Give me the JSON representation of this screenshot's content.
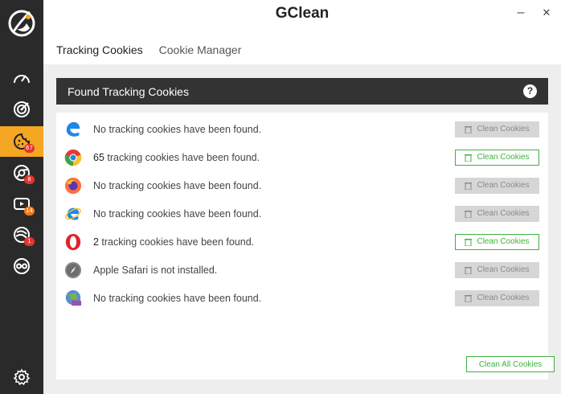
{
  "app": {
    "title": "GClean"
  },
  "window": {
    "minimize_glyph": "–",
    "close_glyph": "✕"
  },
  "tabs": [
    {
      "label": "Tracking Cookies",
      "active": true
    },
    {
      "label": "Cookie Manager",
      "active": false
    }
  ],
  "sidebar": {
    "items": [
      {
        "icon": "speedometer-icon"
      },
      {
        "icon": "target-icon"
      },
      {
        "icon": "cookie-icon",
        "badge": "67",
        "active": true
      },
      {
        "icon": "chrome-icon",
        "badge": "8"
      },
      {
        "icon": "youtube-icon",
        "badge": "14"
      },
      {
        "icon": "tracking-icon",
        "badge": "1"
      },
      {
        "icon": "glasses-icon"
      }
    ],
    "settings_icon": "gear-icon"
  },
  "section": {
    "title": "Found Tracking Cookies",
    "help_label": "?"
  },
  "rows": [
    {
      "browser": "edge",
      "icon": "edge-icon",
      "count": "",
      "message": "No tracking cookies have been found.",
      "button": "Clean Cookies",
      "enabled": false
    },
    {
      "browser": "chrome",
      "icon": "chrome-icon",
      "count": "65",
      "message": " tracking cookies have been found.",
      "button": "Clean Cookies",
      "enabled": true
    },
    {
      "browser": "firefox",
      "icon": "firefox-icon",
      "count": "",
      "message": "No tracking cookies have been found.",
      "button": "Clean Cookies",
      "enabled": false
    },
    {
      "browser": "ie",
      "icon": "internet-explorer-icon",
      "count": "",
      "message": "No tracking cookies have been found.",
      "button": "Clean Cookies",
      "enabled": false
    },
    {
      "browser": "opera",
      "icon": "opera-icon",
      "count": "2",
      "message": " tracking cookies have been found.",
      "button": "Clean Cookies",
      "enabled": true
    },
    {
      "browser": "safari",
      "icon": "safari-icon",
      "count": "",
      "message": "Apple Safari is not installed.",
      "button": "Clean Cookies",
      "enabled": false
    },
    {
      "browser": "other",
      "icon": "globe-www-icon",
      "count": "",
      "message": "No tracking cookies have been found.",
      "button": "Clean Cookies",
      "enabled": false
    }
  ],
  "footer": {
    "clean_all_label": "Clean All Cookies"
  },
  "colors": {
    "accent": "#f5a623",
    "sidebar": "#2a2a2a",
    "success": "#3fb13f",
    "badge": "#e8332b"
  }
}
